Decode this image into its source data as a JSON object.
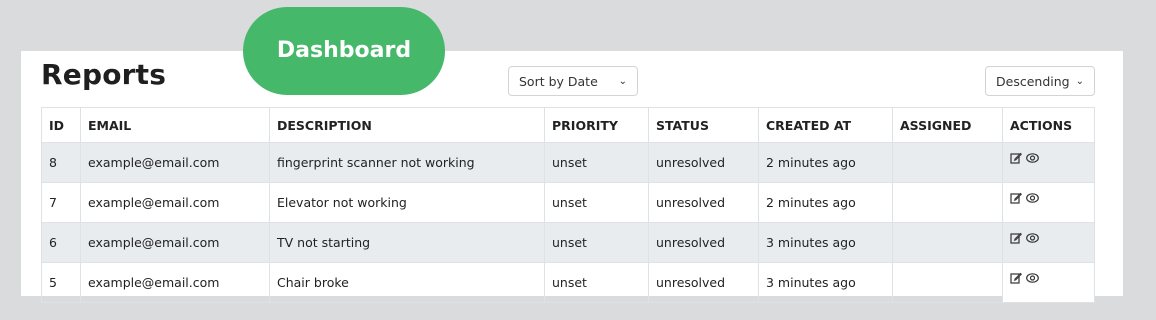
{
  "page": {
    "title": "Reports",
    "dashboard_label": "Dashboard"
  },
  "controls": {
    "sort_value": "Sort by Date",
    "order_value": "Descending"
  },
  "table": {
    "headers": [
      "ID",
      "EMAIL",
      "DESCRIPTION",
      "PRIORITY",
      "STATUS",
      "CREATED AT",
      "ASSIGNED",
      "ACTIONS"
    ],
    "rows": [
      {
        "id": "8",
        "email": "example@email.com",
        "description": "fingerprint scanner not working",
        "priority": "unset",
        "status": "unresolved",
        "created_at": "2 minutes ago",
        "assigned": ""
      },
      {
        "id": "7",
        "email": "example@email.com",
        "description": "Elevator not working",
        "priority": "unset",
        "status": "unresolved",
        "created_at": "2 minutes ago",
        "assigned": ""
      },
      {
        "id": "6",
        "email": "example@email.com",
        "description": "TV not starting",
        "priority": "unset",
        "status": "unresolved",
        "created_at": "3 minutes ago",
        "assigned": ""
      },
      {
        "id": "5",
        "email": "example@email.com",
        "description": "Chair broke",
        "priority": "unset",
        "status": "unresolved",
        "created_at": "3 minutes ago",
        "assigned": ""
      }
    ],
    "action_icons": [
      "edit-icon",
      "view-icon"
    ]
  },
  "colors": {
    "dashboard_button": "#45b86a",
    "background": "#d9dbdd",
    "stripe": "#e9ecef"
  }
}
